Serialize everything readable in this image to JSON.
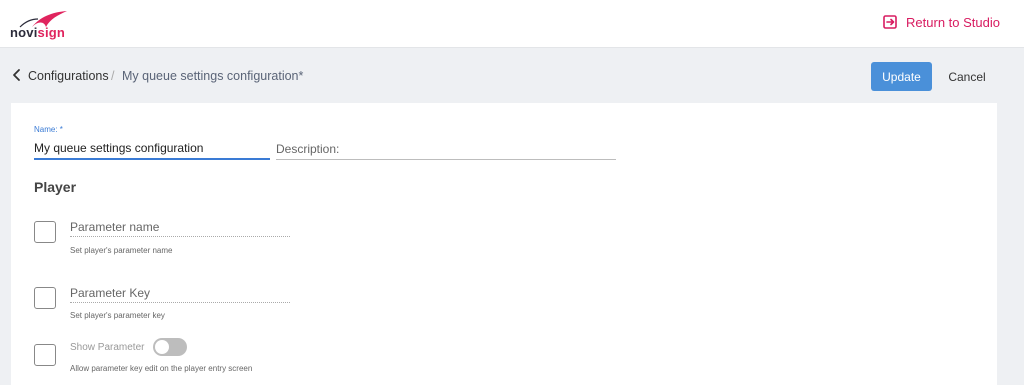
{
  "header": {
    "logo": {
      "part1": "novi",
      "part2": "sign",
      "icon": "novisign-swoosh-logo"
    },
    "return_label": "Return to Studio",
    "return_icon": "exit-to-app-icon"
  },
  "breadcrumb": {
    "back_icon": "chevron-left-icon",
    "parent": "Configurations",
    "separator": "/",
    "current": "My queue settings configuration*"
  },
  "actions": {
    "update": "Update",
    "cancel": "Cancel"
  },
  "form": {
    "name_label": "Name: *",
    "name_value": "My queue settings configuration",
    "description_placeholder": "Description:",
    "description_value": ""
  },
  "player": {
    "title": "Player",
    "params": [
      {
        "placeholder": "Parameter name",
        "hint": "Set player's parameter name",
        "checked": false
      },
      {
        "placeholder": "Parameter Key",
        "hint": "Set player's parameter key",
        "checked": false
      }
    ],
    "show_parameter": {
      "label": "Show Parameter",
      "enabled": false,
      "hint": "Allow parameter key edit on the player entry screen",
      "checked": false
    }
  },
  "colors": {
    "accent": "#d81b60",
    "primary": "#4a90d9",
    "focus": "#3a7bd5"
  }
}
